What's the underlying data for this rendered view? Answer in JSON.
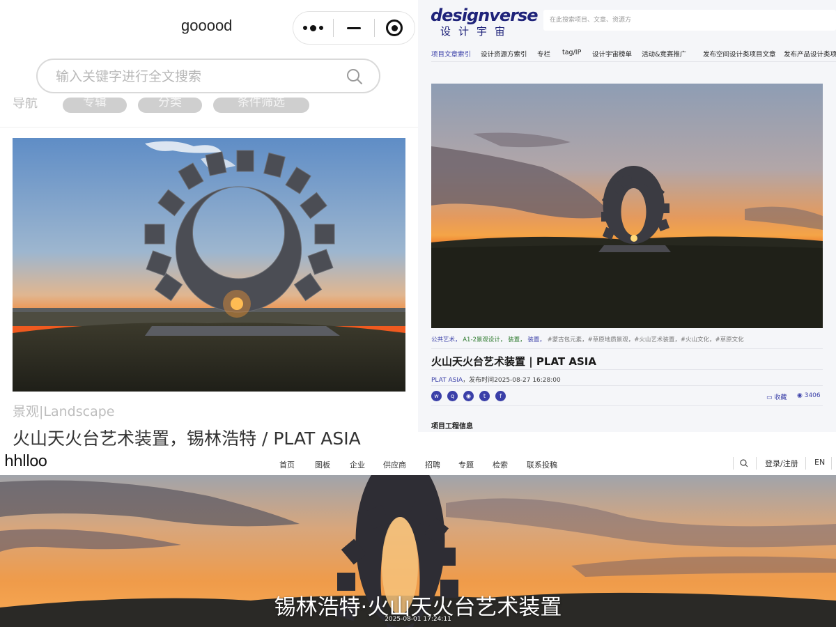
{
  "gooood": {
    "title": "gooood",
    "search": {
      "placeholder": "输入关键字进行全文搜索",
      "value": ""
    },
    "nav": {
      "label": "导航",
      "chips": [
        "专辑",
        "分类",
        "条件筛选"
      ]
    },
    "article": {
      "category": "景观|Landscape",
      "title": "火山天火台艺术装置，锡林浩特 / PLAT ASIA"
    },
    "icons": [
      "more-dots-icon",
      "minimize-icon",
      "record-icon",
      "search-icon"
    ]
  },
  "designverse": {
    "logo_en": "designverse",
    "logo_cn": "设计宇宙",
    "search": {
      "placeholder": "在此搜索项目、文章、资源方",
      "value": ""
    },
    "nav": [
      "项目文章索引",
      "设计资源方索引",
      "专栏",
      "tag/IP",
      "设计宇宙榜单",
      "活动&竞赛推广",
      "发布空间设计类项目文章",
      "发布产品设计类项目"
    ],
    "tags": {
      "primary": [
        "公共艺术，",
        "A1-2景观设计，",
        "装置，",
        "装置，"
      ],
      "hashtags": "#蒙古包元素，#草原地质景观，#火山艺术装置，#火山文化，#草原文化"
    },
    "article": {
      "title": "火山天火台艺术装置 | PLAT ASIA",
      "author": "PLAT ASIA",
      "published": "，发布时间2025-08-27 16:28:00",
      "favorite_label": "收藏",
      "views": "3406",
      "section": "项目工程信息"
    },
    "share_icons": [
      "weibo-icon",
      "qq-icon",
      "wechat-icon",
      "twitter-icon",
      "facebook-icon"
    ],
    "colors": {
      "accent": "#3a3fa8",
      "tag_green": "#2d7a2d"
    }
  },
  "hhlloo": {
    "logo": "hhlloo",
    "nav": [
      "首页",
      "图板",
      "企业",
      "供应商",
      "招聘",
      "专题",
      "检索",
      "联系投稿"
    ],
    "login": "登录/注册",
    "lang": "EN",
    "hero": {
      "title": "锡林浩特·火山天火台艺术装置",
      "date": "2025-08-01 17:24:11"
    }
  }
}
